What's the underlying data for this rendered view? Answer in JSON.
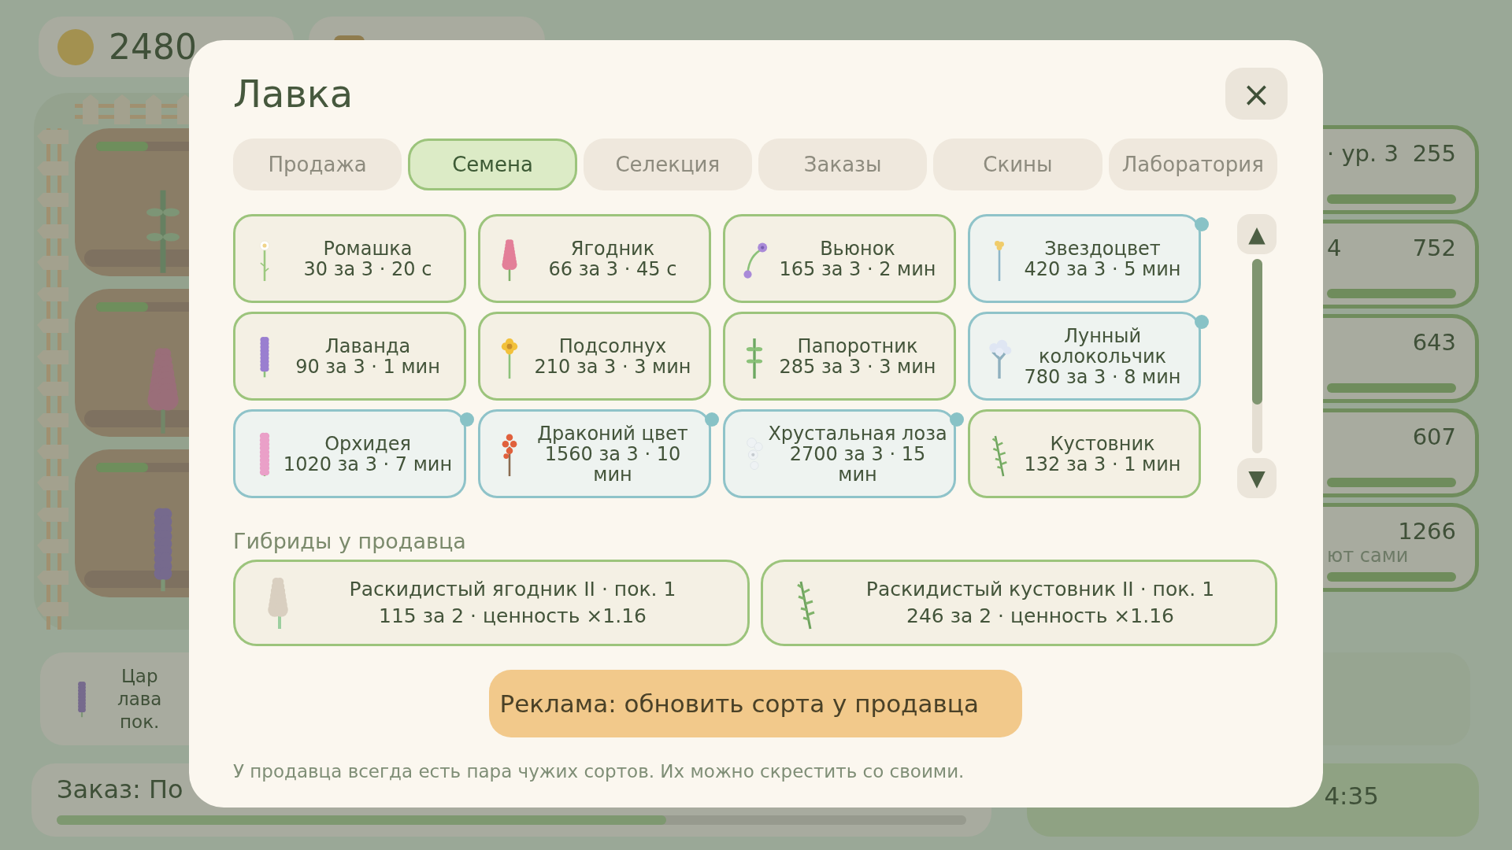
{
  "hud": {
    "coins": "2480"
  },
  "side_cards": [
    {
      "label": "· ур. 3",
      "value": "255"
    },
    {
      "label": "4",
      "value": "752"
    },
    {
      "value": "643"
    },
    {
      "value": "607"
    },
    {
      "value": "1266",
      "note": "ют сами"
    }
  ],
  "bottom_card": {
    "lines": [
      "Цар",
      "лава",
      "пок."
    ]
  },
  "order": {
    "label": "Заказ: По",
    "level": 0.67
  },
  "timer": "4:35",
  "shop": {
    "title": "Лавка",
    "close": "×",
    "tabs": [
      {
        "label": "Продажа",
        "selected": false
      },
      {
        "label": "Семена",
        "selected": true
      },
      {
        "label": "Селекция",
        "selected": false
      },
      {
        "label": "Заказы",
        "selected": false
      },
      {
        "label": "Скины",
        "selected": false
      },
      {
        "label": "Лаборатория",
        "selected": false
      }
    ],
    "seeds": [
      {
        "name": "Ромашка",
        "stats": "30 за 3 · 20 с",
        "rare": false
      },
      {
        "name": "Ягодник",
        "stats": "66 за 3 · 45 с",
        "rare": false
      },
      {
        "name": "Вьюнок",
        "stats": "165 за 3 · 2 мин",
        "rare": false
      },
      {
        "name": "Звездоцвет",
        "stats": "420 за 3 · 5 мин",
        "rare": true
      },
      {
        "name": "Лаванда",
        "stats": "90 за 3 · 1 мин",
        "rare": false
      },
      {
        "name": "Подсолнух",
        "stats": "210 за 3 · 3 мин",
        "rare": false
      },
      {
        "name": "Папоротник",
        "stats": "285 за 3 · 3 мин",
        "rare": false
      },
      {
        "name": "Лунный колокольчик",
        "stats": "780 за 3 · 8 мин",
        "rare": true
      },
      {
        "name": "Орхидея",
        "stats": "1020 за 3 · 7 мин",
        "rare": true
      },
      {
        "name": "Драконий цвет",
        "stats": "1560 за 3 · 10 мин",
        "rare": true
      },
      {
        "name": "Хрустальная лоза",
        "stats": "2700 за 3 · 15 мин",
        "rare": true
      },
      {
        "name": "Кустовник",
        "stats": "132 за 3 · 1 мин",
        "rare": false
      }
    ],
    "scroll_up": "▲",
    "scroll_down": "▼",
    "hybrids_title": "Гибриды у продавца",
    "hybrids": [
      {
        "title": "Раскидистый ягодник II · пок. 1",
        "stats": "115 за 2 · ценность ×1.16"
      },
      {
        "title": "Раскидистый кустовник II · пок. 1",
        "stats": "246 за 2 · ценность ×1.16"
      }
    ],
    "ad_button": "Реклама: обновить сорта у продавца",
    "note": "У продавца всегда есть пара чужих сортов. Их можно скрестить со своими."
  }
}
